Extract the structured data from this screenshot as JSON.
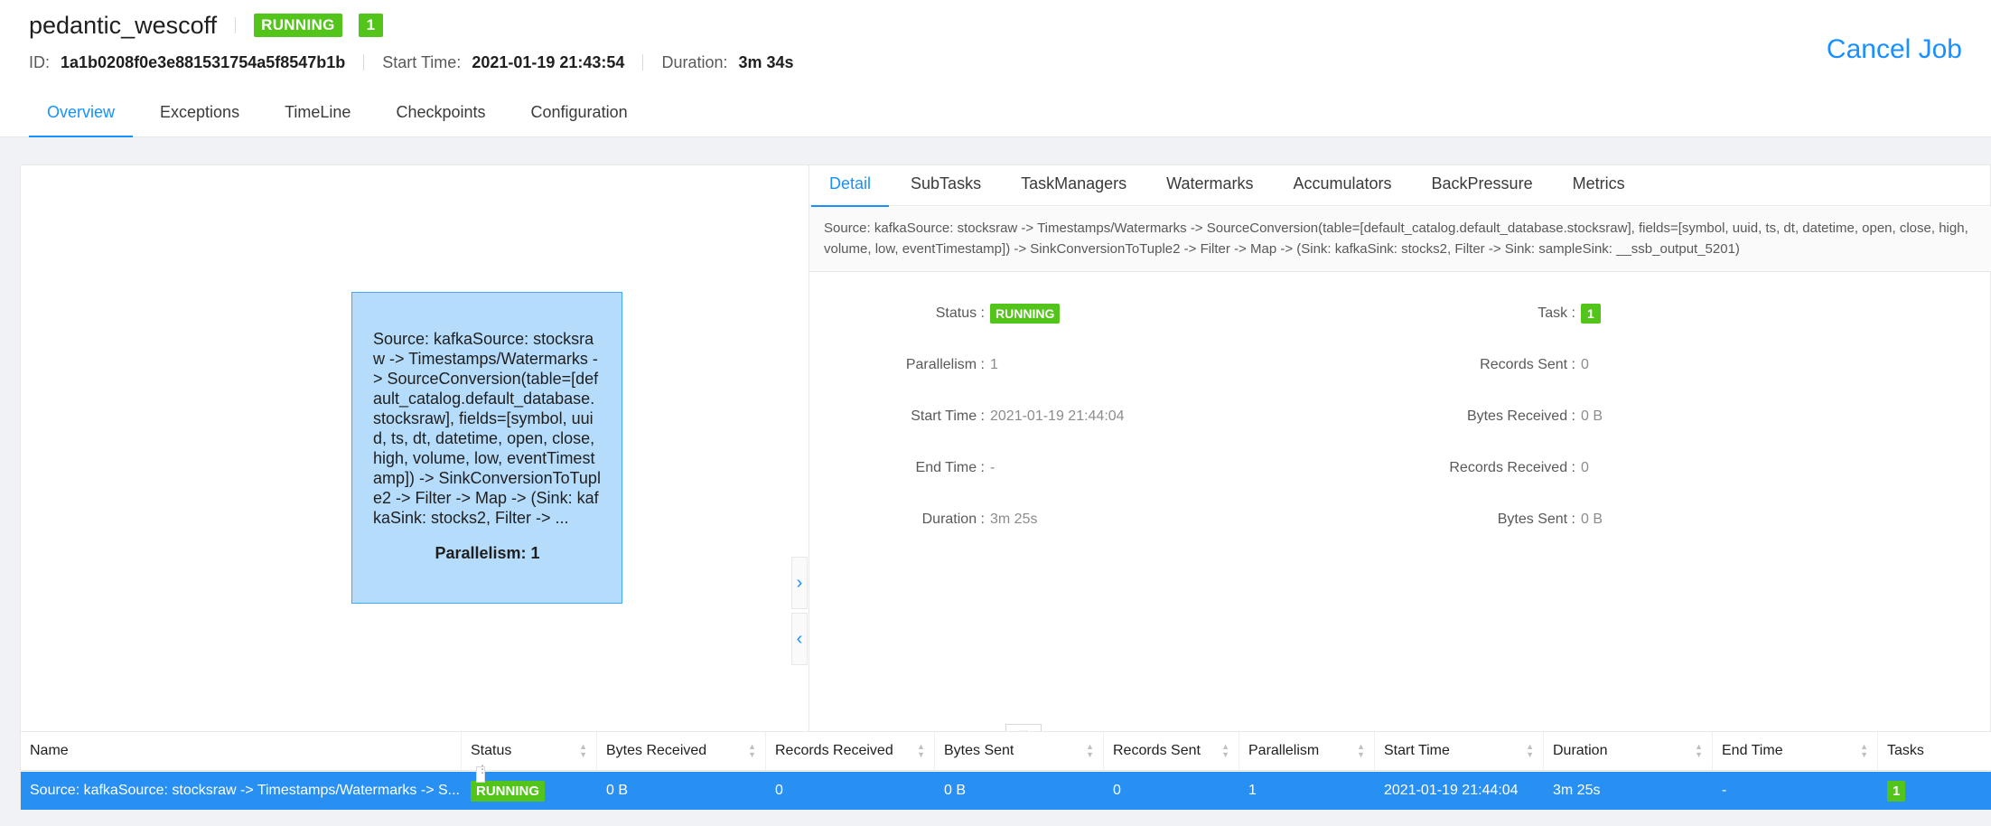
{
  "job": {
    "name": "pedantic_wescoff",
    "status": "RUNNING",
    "task_count": "1",
    "id_label": "ID:",
    "id": "1a1b0208f0e3e881531754a5f8547b1b",
    "start_label": "Start Time:",
    "start_time": "2021-01-19 21:43:54",
    "duration_label": "Duration:",
    "duration": "3m 34s",
    "cancel_label": "Cancel Job"
  },
  "main_tabs": [
    "Overview",
    "Exceptions",
    "TimeLine",
    "Checkpoints",
    "Configuration"
  ],
  "graph": {
    "node_text": "Source: kafkaSource: stocksraw -> Timestamps/Watermarks -> SourceConversion(table=[default_catalog.default_database.stocksraw], fields=[symbol, uuid, ts, dt, datetime, open, close, high, volume, low, eventTimestamp]) -> SinkConversionToTuple2 -> Filter -> Map -> (Sink: kafkaSink: stocks2, Filter -> ...",
    "parallelism_label": "Parallelism: 1",
    "expand_icon": "chevron-right-icon",
    "collapse_icon": "chevron-left-icon"
  },
  "detail_tabs": [
    "Detail",
    "SubTasks",
    "TaskManagers",
    "Watermarks",
    "Accumulators",
    "BackPressure",
    "Metrics"
  ],
  "detail": {
    "description": "Source: kafkaSource: stocksraw -> Timestamps/Watermarks -> SourceConversion(table=[default_catalog.default_database.stocksraw], fields=[symbol, uuid, ts, dt, datetime, open, close, high, volume, low, eventTimestamp]) -> SinkConversionToTuple2 -> Filter -> Map -> (Sink: kafkaSink: stocks2, Filter -> Sink: sampleSink: __ssb_output_5201)",
    "left": [
      {
        "key": "Status",
        "value": "RUNNING"
      },
      {
        "key": "Parallelism",
        "value": "1"
      },
      {
        "key": "Start Time",
        "value": "2021-01-19 21:44:04"
      },
      {
        "key": "End Time",
        "value": "-"
      },
      {
        "key": "Duration",
        "value": "3m 25s"
      }
    ],
    "right": [
      {
        "key": "Task",
        "value": "1"
      },
      {
        "key": "Records Sent",
        "value": "0"
      },
      {
        "key": "Bytes Received",
        "value": "0 B"
      },
      {
        "key": "Records Received",
        "value": "0"
      },
      {
        "key": "Bytes Sent",
        "value": "0 B"
      }
    ]
  },
  "table": {
    "columns": [
      "Name",
      "Status",
      "Bytes Received",
      "Records Received",
      "Bytes Sent",
      "Records Sent",
      "Parallelism",
      "Start Time",
      "Duration",
      "End Time",
      "Tasks"
    ],
    "row": {
      "name": "Source: kafkaSource: stocksraw -> Timestamps/Watermarks -> S...",
      "status": "RUNNING",
      "bytes_received": "0 B",
      "records_received": "0",
      "bytes_sent": "0 B",
      "records_sent": "0",
      "parallelism": "1",
      "start_time": "2021-01-19 21:44:04",
      "duration": "3m 25s",
      "end_time": "-",
      "tasks": "1"
    }
  },
  "colors": {
    "accent": "#1890ff",
    "running": "#52c41a",
    "node_fill": "#b6dcfb",
    "selected_row": "#2990f3"
  }
}
